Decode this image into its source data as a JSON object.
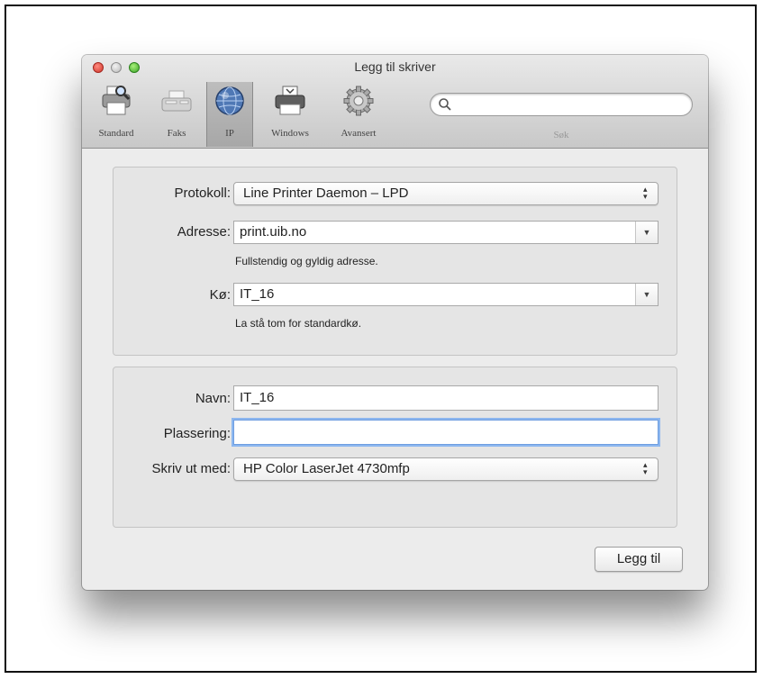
{
  "window": {
    "title": "Legg til skriver"
  },
  "toolbar": {
    "items": [
      {
        "label": "Standard",
        "icon": "printer-magnifier-icon"
      },
      {
        "label": "Faks",
        "icon": "fax-icon"
      },
      {
        "label": "IP",
        "icon": "globe-icon",
        "selected": true
      },
      {
        "label": "Windows",
        "icon": "windows-printer-icon"
      },
      {
        "label": "Avansert",
        "icon": "gear-icon"
      }
    ],
    "search": {
      "label": "Søk",
      "value": ""
    }
  },
  "connection": {
    "protocol_label": "Protokoll:",
    "protocol_value": "Line Printer Daemon – LPD",
    "address_label": "Adresse:",
    "address_value": "print.uib.no",
    "address_hint": "Fullstendig og gyldig adresse.",
    "queue_label": "Kø:",
    "queue_value": "IT_16",
    "queue_hint": "La stå tom for standardkø."
  },
  "details": {
    "name_label": "Navn:",
    "name_value": "IT_16",
    "location_label": "Plassering:",
    "location_value": "",
    "driver_label": "Skriv ut med:",
    "driver_value": "HP Color LaserJet 4730mfp"
  },
  "actions": {
    "add_label": "Legg til"
  }
}
